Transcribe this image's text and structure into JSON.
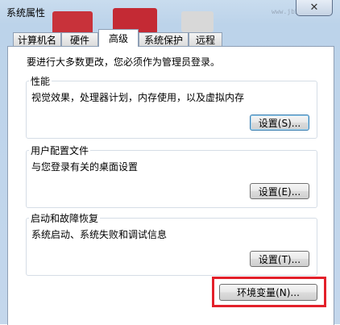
{
  "window": {
    "title": "系统属性",
    "close_icon": "✕"
  },
  "tabs": [
    {
      "label": "计算机名"
    },
    {
      "label": "硬件"
    },
    {
      "label": "高级",
      "active": true
    },
    {
      "label": "系统保护"
    },
    {
      "label": "远程"
    }
  ],
  "advanced": {
    "intro": "要进行大多数更改，您必须作为管理员登录。",
    "performance": {
      "title": "性能",
      "description": "视觉效果，处理器计划，内存使用，以及虚拟内存",
      "button": "设置(S)..."
    },
    "user_profiles": {
      "title": "用户配置文件",
      "description": "与您登录有关的桌面设置",
      "button": "设置(E)..."
    },
    "startup_recovery": {
      "title": "启动和故障恢复",
      "description": "系统启动、系统失败和调试信息",
      "button": "设置(T)..."
    },
    "env_button": "环境变量(N)..."
  },
  "colors": {
    "highlight": "#e3202a",
    "frame": "#c4d7ec"
  }
}
